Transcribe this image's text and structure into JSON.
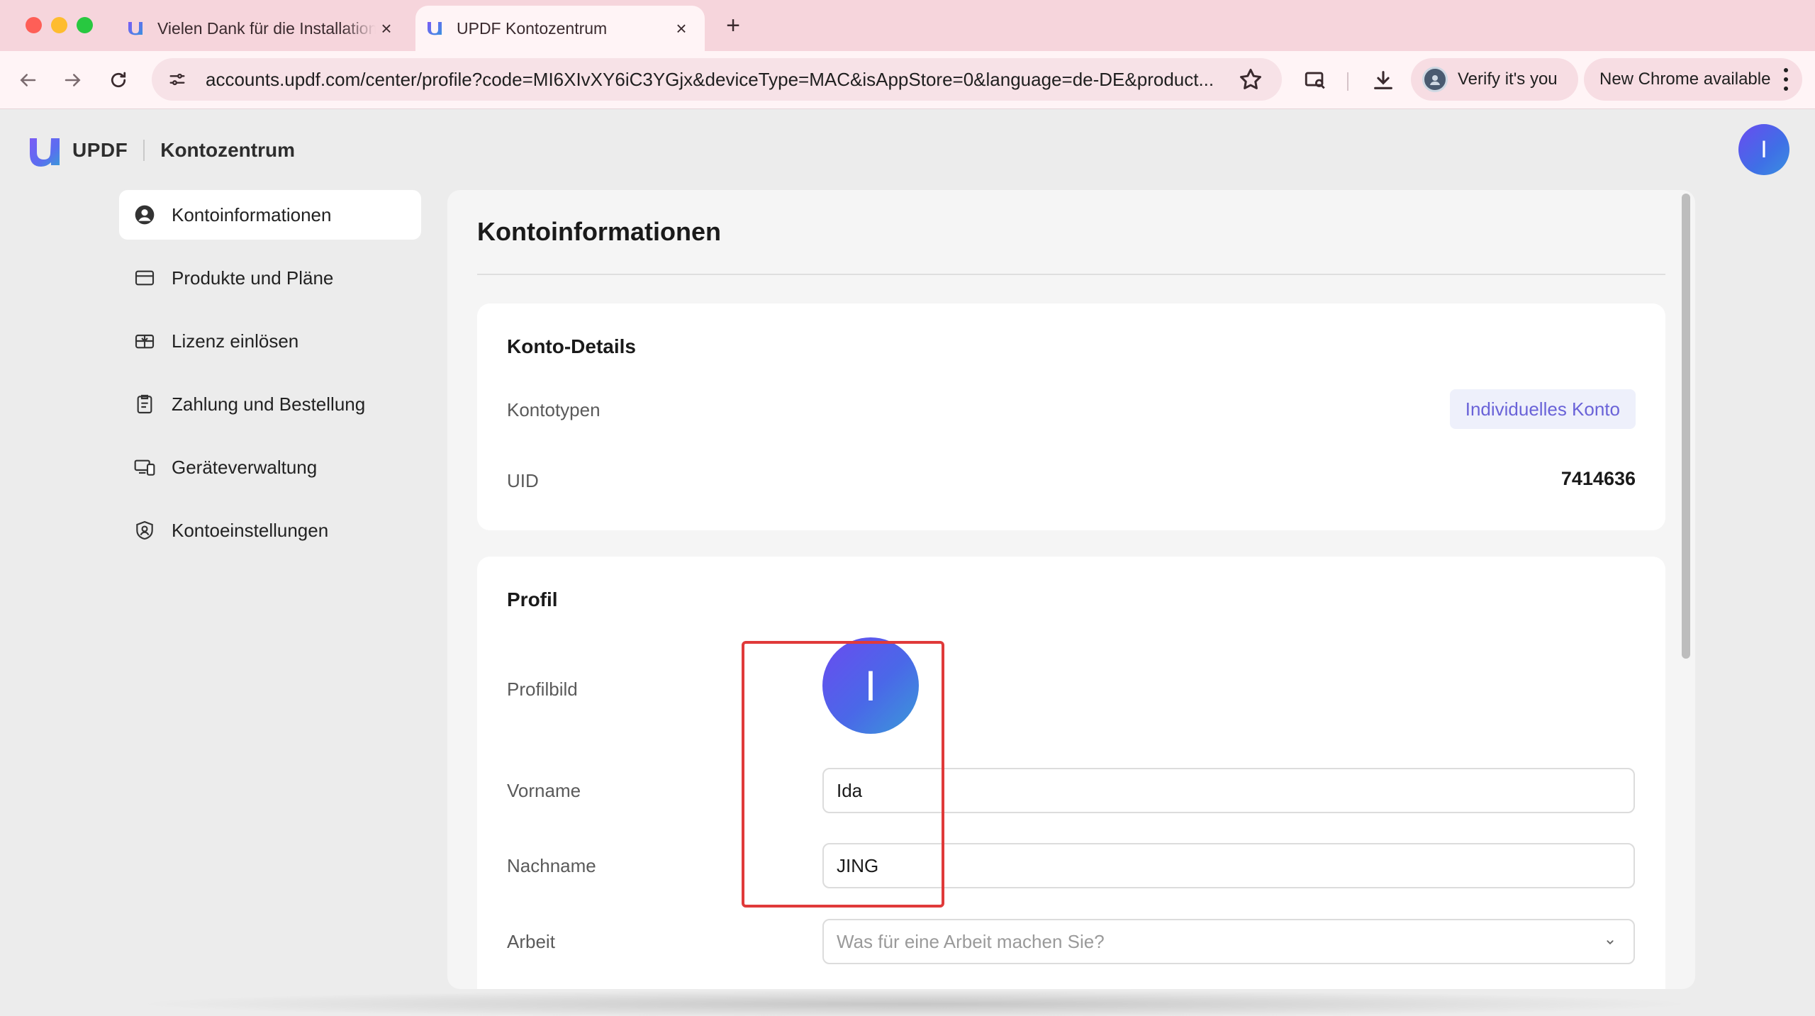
{
  "browser": {
    "tabs": [
      {
        "title": "Vielen Dank für die Installation",
        "active": false
      },
      {
        "title": "UPDF Kontozentrum",
        "active": true
      }
    ],
    "url": "accounts.updf.com/center/profile?code=MI6XIvXY6iC3YGjx&deviceType=MAC&isAppStore=0&language=de-DE&product...",
    "verify_label": "Verify it's you",
    "update_label": "New Chrome available",
    "icons": [
      "back-icon",
      "forward-icon",
      "reload-icon",
      "site-info-icon",
      "star-icon",
      "search-tab-icon",
      "download-icon",
      "kebab-icon"
    ]
  },
  "header": {
    "brand": "UPDF",
    "subtitle": "Kontozentrum",
    "user_initial": "I"
  },
  "sidebar": {
    "items": [
      {
        "label": "Kontoinformationen",
        "icon": "user-circle-icon",
        "active": true
      },
      {
        "label": "Produkte und Pläne",
        "icon": "card-icon",
        "active": false
      },
      {
        "label": "Lizenz einlösen",
        "icon": "gift-icon",
        "active": false
      },
      {
        "label": "Zahlung und Bestellung",
        "icon": "clipboard-icon",
        "active": false
      },
      {
        "label": "Geräteverwaltung",
        "icon": "devices-icon",
        "active": false
      },
      {
        "label": "Kontoeinstellungen",
        "icon": "shield-user-icon",
        "active": false
      }
    ]
  },
  "main": {
    "title": "Kontoinformationen",
    "details": {
      "title": "Konto-Details",
      "account_type_label": "Kontotypen",
      "account_type_value": "Individuelles Konto",
      "uid_label": "UID",
      "uid_value": "7414636"
    },
    "profile": {
      "title": "Profil",
      "picture_label": "Profilbild",
      "avatar_initial": "I",
      "first_name_label": "Vorname",
      "first_name_value": "Ida",
      "last_name_label": "Nachname",
      "last_name_value": "JING",
      "job_label": "Arbeit",
      "job_placeholder": "Was für eine Arbeit machen Sie?"
    }
  },
  "colors": {
    "accent_gradient_start": "#6a4bf0",
    "accent_gradient_end": "#3a90e0",
    "badge_text": "#6a63d8",
    "highlight_border": "#e03a3a",
    "tab_strip": "#f6d5dc"
  }
}
